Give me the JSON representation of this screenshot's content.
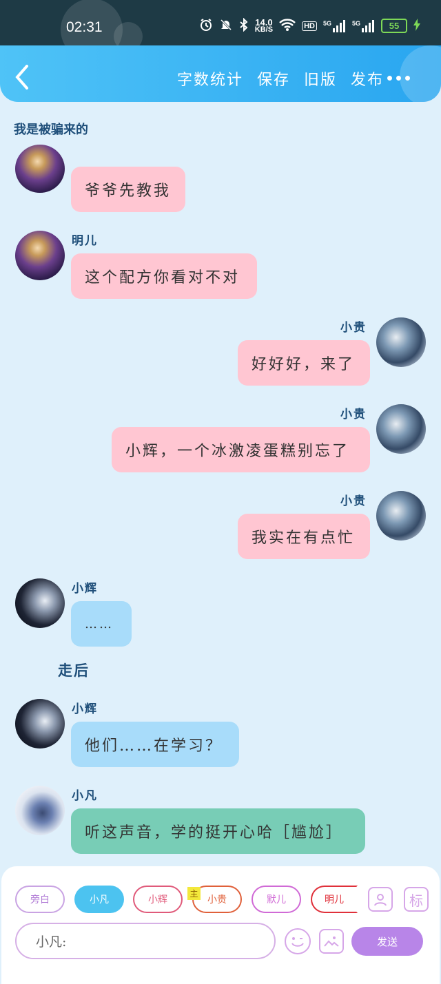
{
  "status_bar": {
    "time": "02:31",
    "net_speed_value": "14.0",
    "net_speed_unit": "KB/S",
    "hd": "HD",
    "sig1": "5G",
    "sig2": "5G",
    "battery": "55"
  },
  "toolbar": {
    "word_count": "字数统计",
    "save": "保存",
    "old_version": "旧版",
    "publish": "发布"
  },
  "chat_title": "我是被骗来的",
  "messages": [
    {
      "text": "爷爷先教我"
    },
    {
      "sender": "明儿",
      "text": "这个配方你看对不对"
    },
    {
      "sender": "小贵",
      "text": "好好好，来了"
    },
    {
      "sender": "小贵",
      "text": "小辉，一个冰激凌蛋糕别忘了"
    },
    {
      "sender": "小贵",
      "text": "我实在有点忙"
    },
    {
      "sender": "小辉",
      "text": "……"
    },
    {
      "sender": "小辉",
      "text": "他们……在学习？"
    },
    {
      "sender": "小凡",
      "text": "听这声音，学的挺开心哈［尴尬］"
    }
  ],
  "narration": "走后",
  "roles": [
    "旁白",
    "小凡",
    "小辉",
    "小贵",
    "默儿",
    "明儿"
  ],
  "role_tag": "主",
  "icon_label_tag": "标",
  "input": {
    "placeholder": "小凡:"
  },
  "send_label": "发送",
  "colors": {
    "accent": "#29a6f0",
    "pink_bubble": "#ffc6d2",
    "blue_bubble": "#a8dcfa",
    "teal_bubble": "#78cdb6",
    "send": "#b885e8"
  }
}
